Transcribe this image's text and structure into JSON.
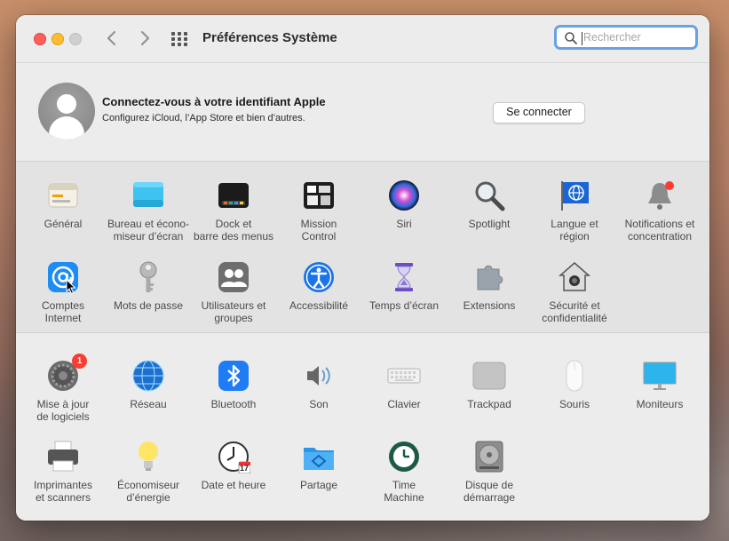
{
  "window": {
    "title": "Préférences Système",
    "search_placeholder": "Rechercher"
  },
  "account": {
    "title": "Connectez-vous à votre identifiant Apple",
    "subtitle": "Configurez iCloud, l’App Store et bien d’autres.",
    "signin_label": "Se connecter"
  },
  "section1": [
    {
      "label": "Général",
      "icon": "general-icon"
    },
    {
      "label": "Bureau et écono-\nmiseur d’écran",
      "icon": "desktop-icon"
    },
    {
      "label": "Dock et\nbarre des menus",
      "icon": "dock-icon"
    },
    {
      "label": "Mission\nControl",
      "icon": "mission-control-icon"
    },
    {
      "label": "Siri",
      "icon": "siri-icon"
    },
    {
      "label": "Spotlight",
      "icon": "spotlight-icon"
    },
    {
      "label": "Langue et\nrégion",
      "icon": "language-icon"
    },
    {
      "label": "Notifications et\nconcentration",
      "icon": "notifications-icon"
    },
    {
      "label": "Comptes\nInternet",
      "icon": "internet-accounts-icon"
    },
    {
      "label": "Mots de passe",
      "icon": "passwords-icon"
    },
    {
      "label": "Utilisateurs et\ngroupes",
      "icon": "users-icon"
    },
    {
      "label": "Accessibilité",
      "icon": "accessibility-icon"
    },
    {
      "label": "Temps d’écran",
      "icon": "screen-time-icon"
    },
    {
      "label": "Extensions",
      "icon": "extensions-icon"
    },
    {
      "label": "Sécurité et\nconfidentialité",
      "icon": "security-icon"
    }
  ],
  "section2": [
    {
      "label": "Mise à jour\nde logiciels",
      "icon": "software-update-icon",
      "badge": "1"
    },
    {
      "label": "Réseau",
      "icon": "network-icon"
    },
    {
      "label": "Bluetooth",
      "icon": "bluetooth-icon"
    },
    {
      "label": "Son",
      "icon": "sound-icon"
    },
    {
      "label": "Clavier",
      "icon": "keyboard-icon"
    },
    {
      "label": "Trackpad",
      "icon": "trackpad-icon"
    },
    {
      "label": "Souris",
      "icon": "mouse-icon"
    },
    {
      "label": "Moniteurs",
      "icon": "displays-icon"
    },
    {
      "label": "Imprimantes\net scanners",
      "icon": "printers-icon"
    },
    {
      "label": "Économiseur\nd’énergie",
      "icon": "energy-icon"
    },
    {
      "label": "Date et heure",
      "icon": "date-time-icon",
      "day": "17"
    },
    {
      "label": "Partage",
      "icon": "sharing-icon"
    },
    {
      "label": "Time\nMachine",
      "icon": "time-machine-icon"
    },
    {
      "label": "Disque de\ndémarrage",
      "icon": "startup-disk-icon"
    }
  ]
}
